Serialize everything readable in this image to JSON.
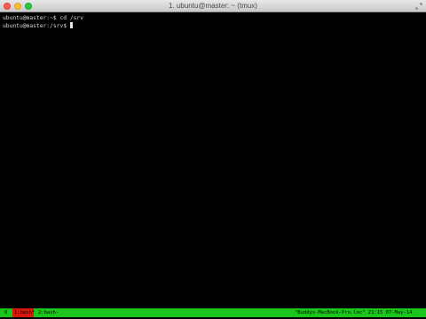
{
  "window": {
    "title": "1. ubuntu@master: ~ (tmux)"
  },
  "terminal": {
    "lines": [
      "ubuntu@master:~$ cd /srv",
      "ubuntu@master:/srv$ "
    ]
  },
  "tmux_status": {
    "session": "0",
    "windows": [
      {
        "label": "1:bash*",
        "active": true
      },
      {
        "label": "2:bash-",
        "active": false
      }
    ],
    "right": "\"Buddys-MacBook-Pro.loc\" 21:15 07-May-14"
  },
  "colors": {
    "status_bar": "#1cc51c",
    "active_window": "#d7180f",
    "terminal_bg": "#000000"
  }
}
